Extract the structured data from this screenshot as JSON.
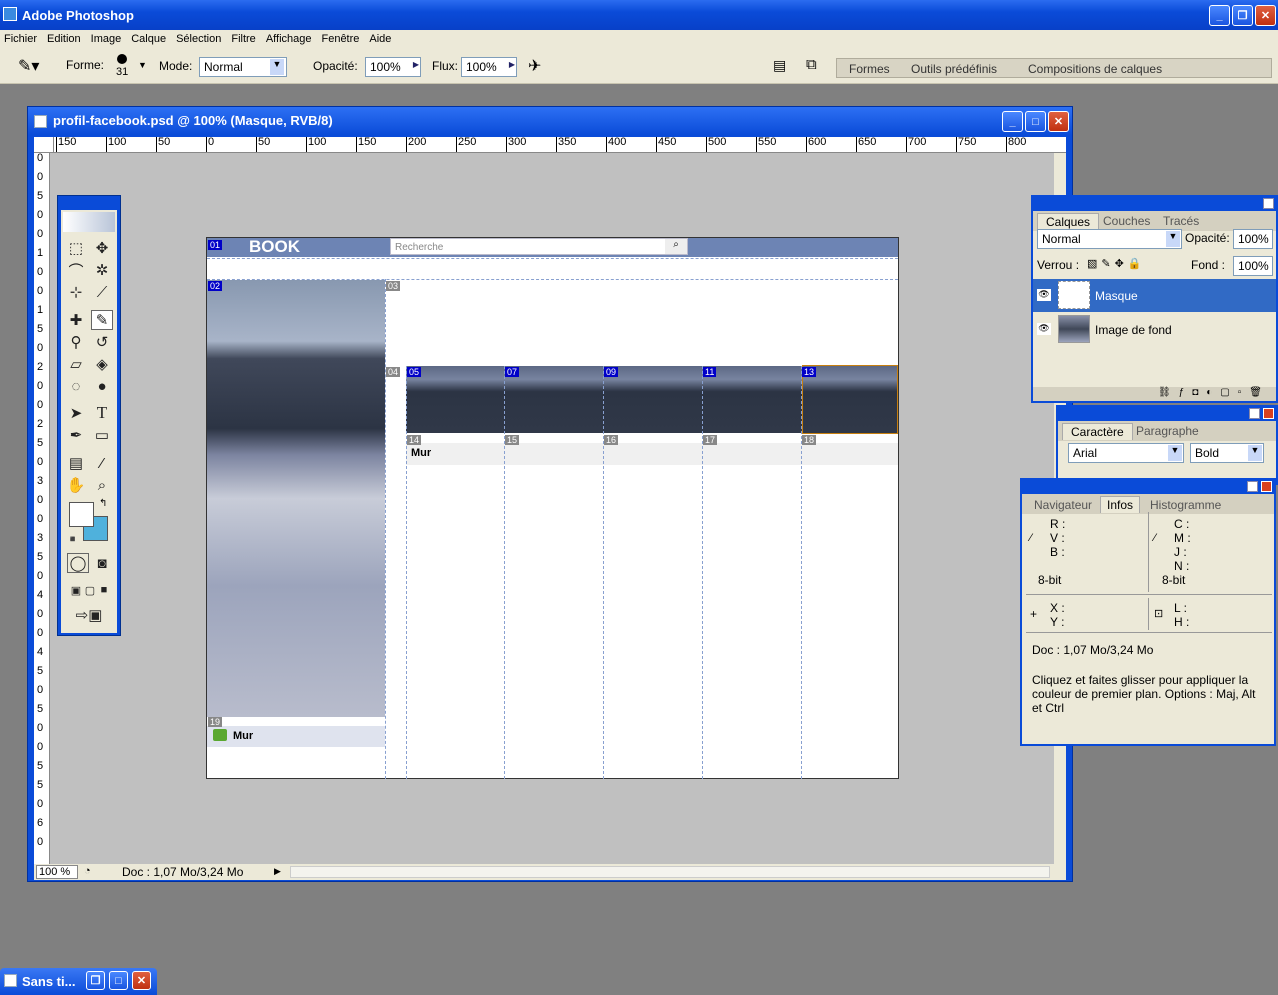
{
  "app": {
    "title": "Adobe Photoshop"
  },
  "menu": [
    "Fichier",
    "Edition",
    "Image",
    "Calque",
    "Sélection",
    "Filtre",
    "Affichage",
    "Fenêtre",
    "Aide"
  ],
  "options": {
    "forme_label": "Forme:",
    "brush_size": "31",
    "mode_label": "Mode:",
    "mode_value": "Normal",
    "opacite_label": "Opacité:",
    "opacite_value": "100%",
    "flux_label": "Flux:",
    "flux_value": "100%",
    "well_tabs": [
      "Formes",
      "Outils prédéfinis",
      "Compositions de calques"
    ]
  },
  "document": {
    "title": "profil-facebook.psd @ 100% (Masque, RVB/8)",
    "zoom": "100 %",
    "doc_info": "Doc : 1,07 Mo/3,24 Mo",
    "hruler_ticks": [
      "150",
      "100",
      "50",
      "0",
      "50",
      "100",
      "150",
      "200",
      "250",
      "300",
      "350",
      "400",
      "450",
      "500",
      "550",
      "600",
      "650",
      "700",
      "750",
      "800"
    ],
    "vruler_ticks": [
      "0",
      "0",
      "5",
      "0",
      "0",
      "1",
      "0",
      "0",
      "1",
      "5",
      "0",
      "2",
      "0",
      "0",
      "2",
      "5",
      "0",
      "3",
      "0",
      "0",
      "3",
      "5",
      "0",
      "4",
      "0",
      "0",
      "4",
      "5",
      "0",
      "5",
      "0",
      "0",
      "5",
      "5",
      "0",
      "6",
      "0"
    ]
  },
  "psd": {
    "logo": "BOOK",
    "search_placeholder": "Recherche",
    "slices": [
      "01",
      "02",
      "03",
      "04",
      "05",
      "07",
      "09",
      "11",
      "13",
      "14",
      "15",
      "16",
      "17",
      "18",
      "19"
    ],
    "wall_label_1": "Mur",
    "wall_label_2": "Mur"
  },
  "layers_panel": {
    "tabs": [
      "Calques",
      "Couches",
      "Tracés"
    ],
    "blend_mode": "Normal",
    "opacite_label": "Opacité:",
    "opacite_value": "100%",
    "verrou_label": "Verrou :",
    "fond_label": "Fond :",
    "fond_value": "100%",
    "layers": [
      {
        "name": "Masque",
        "selected": true
      },
      {
        "name": "Image de fond",
        "selected": false
      }
    ]
  },
  "char_panel": {
    "tabs": [
      "Caractère",
      "Paragraphe"
    ],
    "font_family": "Arial",
    "font_style": "Bold"
  },
  "info_panel": {
    "tabs": [
      "Navigateur",
      "Infos",
      "Histogramme"
    ],
    "rgb": [
      "R :",
      "V :",
      "B :"
    ],
    "cmyk": [
      "C :",
      "M :",
      "J :",
      "N :"
    ],
    "bit_left": "8-bit",
    "bit_right": "8-bit",
    "xy": [
      "X :",
      "Y :"
    ],
    "lh": [
      "L :",
      "H :"
    ],
    "doc": "Doc : 1,07 Mo/3,24 Mo",
    "hint": "Cliquez et faites glisser pour appliquer la couleur de premier plan. Options : Maj, Alt  et Ctrl"
  },
  "minimized": {
    "title": "Sans ti..."
  },
  "colors": {
    "xp_blue": "#0a4bd8",
    "chrome": "#ece9d8",
    "fb_blue": "#6d84b4",
    "selected_layer": "#316ac5",
    "background_color": "#4fb1dc"
  }
}
